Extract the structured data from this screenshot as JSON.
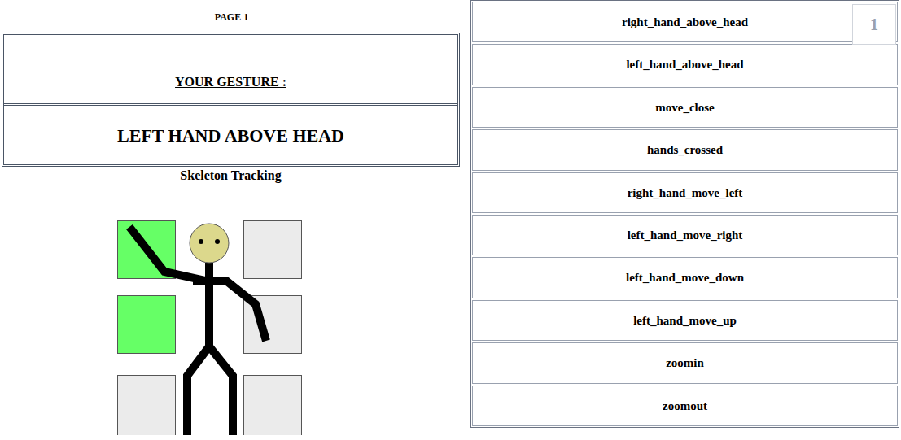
{
  "page_label": "PAGE 1",
  "gesture_panel": {
    "heading": "YOUR GESTURE :",
    "gesture": "LEFT HAND ABOVE HEAD"
  },
  "tracking": {
    "title": "Skeleton Tracking",
    "zones": [
      {
        "position": "top-left",
        "selected": true
      },
      {
        "position": "top-right",
        "selected": false
      },
      {
        "position": "middle-left",
        "selected": true
      },
      {
        "position": "middle-right",
        "selected": false
      },
      {
        "position": "bottom-left",
        "selected": false
      },
      {
        "position": "bottom-right",
        "selected": false
      }
    ]
  },
  "gesture_list": [
    "right_hand_above_head",
    "left_hand_above_head",
    "move_close",
    "hands_crossed",
    "right_hand_move_left",
    "left_hand_move_right",
    "left_hand_move_down",
    "left_hand_move_up",
    "zoomin",
    "zoomout"
  ],
  "page_badge": "1"
}
